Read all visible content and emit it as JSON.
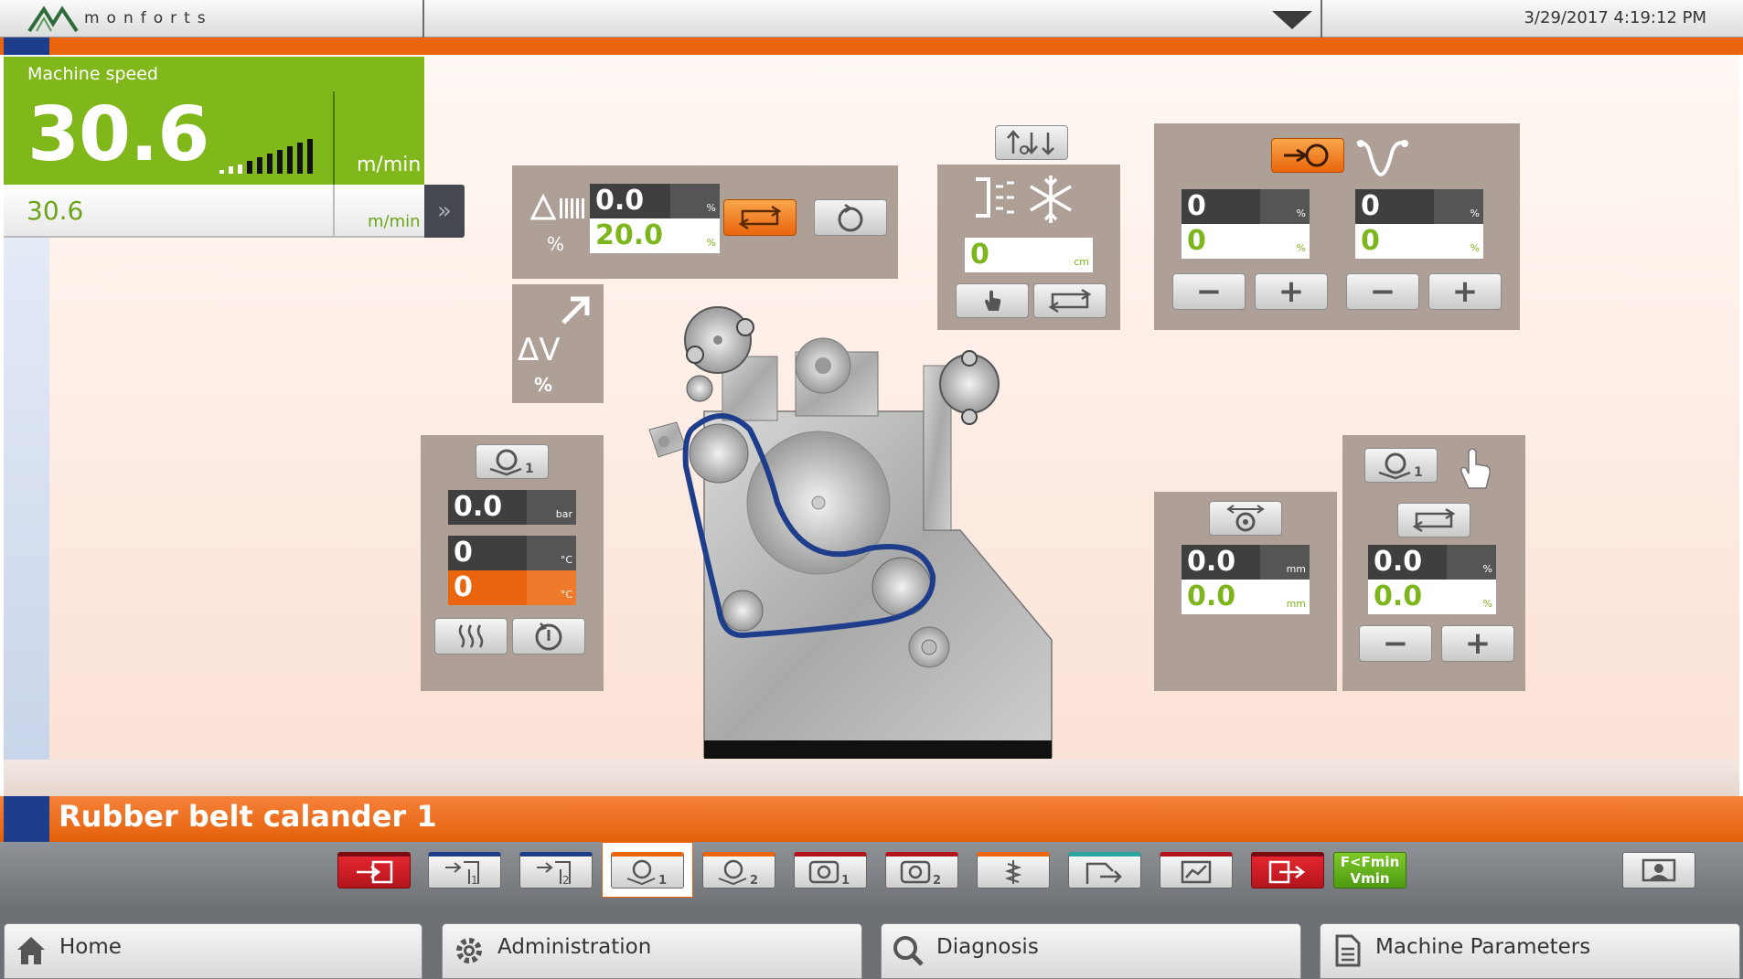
{
  "header": {
    "brand": "monforts",
    "datetime": "3/29/2017 4:19:12 PM"
  },
  "speed": {
    "label": "Machine speed",
    "value": "30.6",
    "unit": "m/min",
    "setpoint": "30.6",
    "setpoint_unit": "m/min"
  },
  "stretch_panel": {
    "actual": "0.0",
    "actual_unit": "%",
    "setpoint": "20.0",
    "setpoint_unit": "%",
    "percent_label": "%"
  },
  "dv_panel": {
    "label": "ΔV",
    "unit": "%"
  },
  "cooling_panel": {
    "value": "0",
    "unit": "cm"
  },
  "tension_panel": {
    "left": {
      "actual": "0",
      "actual_unit": "%",
      "setpoint": "0",
      "setpoint_unit": "%"
    },
    "right": {
      "actual": "0",
      "actual_unit": "%",
      "setpoint": "0",
      "setpoint_unit": "%"
    },
    "minus_label": "−",
    "plus_label": "+"
  },
  "calender_panel": {
    "pressure": "0.0",
    "pressure_unit": "bar",
    "temp_actual": "0",
    "temp_actual_unit": "°C",
    "temp_set": "0",
    "temp_set_unit": "°C"
  },
  "gap_panel": {
    "actual": "0.0",
    "actual_unit": "mm",
    "setpoint": "0.0",
    "setpoint_unit": "mm"
  },
  "belt_panel": {
    "actual": "0.0",
    "actual_unit": "%",
    "setpoint": "0.0",
    "setpoint_unit": "%",
    "minus_label": "−",
    "plus_label": "+"
  },
  "title": "Rubber belt calander 1",
  "toolbar": {
    "fmin_line1": "F<Fmin",
    "fmin_line2": "Vmin",
    "badge_1": "1",
    "badge_2": "2"
  },
  "nav": [
    {
      "label": "Home"
    },
    {
      "label": "Administration"
    },
    {
      "label": "Diagnosis"
    },
    {
      "label": "Machine Parameters"
    }
  ],
  "colors": {
    "accent": "#ea650d",
    "speed_green": "#80b81b",
    "panel": "#ae9f97",
    "brand_blue": "#1e3d8a"
  }
}
